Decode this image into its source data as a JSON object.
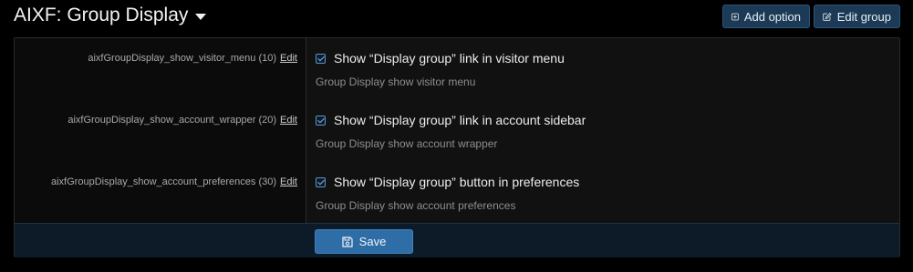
{
  "header": {
    "title": "AIXF: Group Display",
    "add_option_label": "Add option",
    "edit_group_label": "Edit group"
  },
  "options": [
    {
      "key": "aixfGroupDisplay_show_visitor_menu (10)",
      "edit_label": "Edit",
      "checkbox_label": "Show “Display group” link in visitor menu",
      "checked": true,
      "hint": "Group Display show visitor menu"
    },
    {
      "key": "aixfGroupDisplay_show_account_wrapper (20)",
      "edit_label": "Edit",
      "checkbox_label": "Show “Display group” link in account sidebar",
      "checked": true,
      "hint": "Group Display show account wrapper"
    },
    {
      "key": "aixfGroupDisplay_show_account_preferences (30)",
      "edit_label": "Edit",
      "checkbox_label": "Show “Display group” button in preferences",
      "checked": true,
      "hint": "Group Display show account preferences"
    }
  ],
  "footer": {
    "save_label": "Save"
  },
  "colors": {
    "background": "#000000",
    "panel": "#111111",
    "button": "#1c3a55",
    "save_button": "#2f6da6",
    "checkbox_accent": "#5a96cf"
  },
  "icons": {
    "title_dropdown": "caret-down-icon",
    "add_option": "plus-square-icon",
    "edit_group": "edit-icon",
    "save": "save-icon",
    "checkbox": "checkbox-checked-icon"
  }
}
